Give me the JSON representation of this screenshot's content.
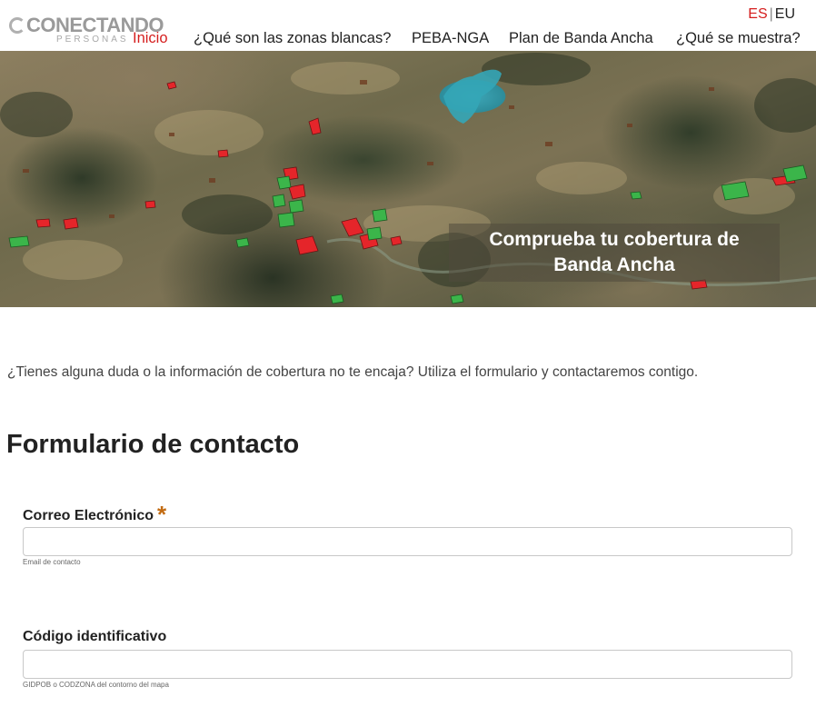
{
  "header": {
    "logo": {
      "main": "CONECTANDO",
      "sub": "PERSONAS"
    },
    "languages": [
      {
        "label": "ES",
        "active": true
      },
      {
        "label": "EU",
        "active": false
      }
    ],
    "language_separator": "|",
    "nav": [
      {
        "label": "Inicio",
        "active": true
      },
      {
        "label": "¿Qué son las zonas blancas?",
        "active": false
      },
      {
        "label": "PEBA-NGA",
        "active": false
      },
      {
        "label": "Plan de Banda Ancha",
        "active": false
      },
      {
        "label": "¿Qué se muestra?",
        "active": false
      }
    ]
  },
  "hero": {
    "title": "Comprueba tu cobertura de Banda Ancha"
  },
  "intro": "¿Tienes alguna duda o la información de cobertura no te encaja? Utiliza el formulario y contactaremos contigo.",
  "form": {
    "title": "Formulario de contacto",
    "fields": [
      {
        "label": "Correo Electrónico",
        "required": true,
        "required_mark": "*",
        "value": "",
        "help": "Email de contacto"
      },
      {
        "label": "Código identificativo",
        "required": false,
        "value": "",
        "help": "GIDPOB o CODZONA del contorno del mapa"
      }
    ]
  },
  "colors": {
    "accent": "#d51e1e",
    "required": "#c26b12",
    "map_green": "#3bb54a",
    "map_red": "#e5252a"
  }
}
